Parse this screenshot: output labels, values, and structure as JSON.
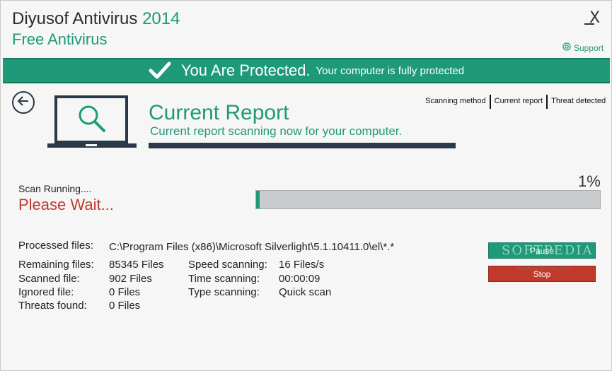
{
  "header": {
    "app_name": "Diyusof Antivirus",
    "app_version": "2014",
    "subtitle": "Free Antivirus",
    "close_label": "X",
    "support_label": "Support"
  },
  "banner": {
    "status_main": "You Are Protected.",
    "status_detail": "Your computer is fully protected"
  },
  "report": {
    "title": "Current Report",
    "subtitle": "Current report scanning now for your computer."
  },
  "tabs": [
    "Scanning method",
    "Current report",
    "Threat detected"
  ],
  "scan": {
    "status": "Scan Running....",
    "wait": "Please Wait...",
    "progress_text": "1%",
    "progress_value": 1
  },
  "details": {
    "processed_label": "Processed files:",
    "processed_value": "C:\\Program Files (x86)\\Microsoft Silverlight\\5.1.10411.0\\el\\*.*",
    "remaining_label": "Remaining files:",
    "remaining_value": "85345 Files",
    "scanned_label": "Scanned file:",
    "scanned_value": "902 Files",
    "ignored_label": "Ignored file:",
    "ignored_value": "0 Files",
    "threats_label": "Threats found:",
    "threats_value": "0 Files",
    "speed_label": "Speed scanning:",
    "speed_value": "16 Files/s",
    "time_label": "Time scanning:",
    "time_value": "00:00:09",
    "type_label": "Type scanning:",
    "type_value": "Quick scan"
  },
  "buttons": {
    "pause": "Pause",
    "stop": "Stop"
  },
  "watermark": {
    "text": "SOFTPEDIA",
    "url": "www.softpedia.com"
  },
  "colors": {
    "accent": "#1e9a78",
    "danger": "#c0392b",
    "dark": "#2a3848"
  }
}
